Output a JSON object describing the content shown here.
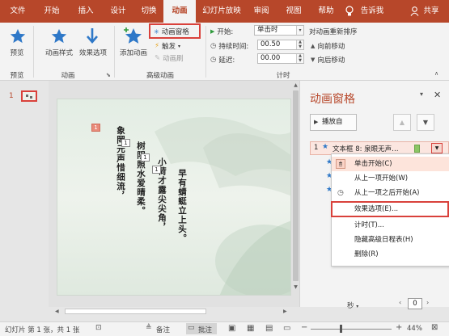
{
  "tabs": [
    "文件",
    "开始",
    "插入",
    "设计",
    "切换",
    "动画",
    "幻灯片放映",
    "审阅",
    "视图",
    "帮助",
    "告诉我",
    "共享"
  ],
  "active_tab": "动画",
  "ribbon": {
    "preview": "预览",
    "preview_group": "预览",
    "anim_style": "动画样式",
    "effect_options": "效果选项",
    "anim_group": "动画",
    "add_anim": "添加动画",
    "anim_pane_btn": "动画窗格",
    "trigger": "触发",
    "anim_painter": "动画刷",
    "advanced_group": "高级动画",
    "start_label": "开始:",
    "start_value": "单击时",
    "duration_label": "持续时间:",
    "duration_value": "00.50",
    "delay_label": "延迟:",
    "delay_value": "00.00",
    "timing_group": "计时",
    "reorder_title": "对动画重新排序",
    "move_earlier": "向前移动",
    "move_later": "向后移动"
  },
  "thumb": {
    "number": "1"
  },
  "slide": {
    "col1": "象罔元声惜细流，",
    "col2": "树阴照水爱晴柔。",
    "col3": "小荷才露尖尖角，",
    "col4": "早有蜻蜓立上头。",
    "markers": [
      "1",
      "1",
      "1",
      "1"
    ]
  },
  "anim_pane": {
    "title": "动画窗格",
    "play_btn": "播放自",
    "item_num": "1",
    "item_label": "文本框 8: 泉眼无声…",
    "timeline_label": "秒",
    "zoom_value": "0"
  },
  "context_menu": {
    "items": [
      "单击开始(C)",
      "从上一项开始(W)",
      "从上一项之后开始(A)",
      "效果选项(E)...",
      "计时(T)...",
      "隐藏高级日程表(H)",
      "删除(R)"
    ]
  },
  "status": {
    "slide_info": "幻灯片 第 1 张，共 1 张",
    "notes": "备注",
    "comments": "批注",
    "zoom": "44%"
  },
  "colors": {
    "accent": "#b7472a",
    "highlight": "#d9413b",
    "star": "#2e78c8"
  }
}
